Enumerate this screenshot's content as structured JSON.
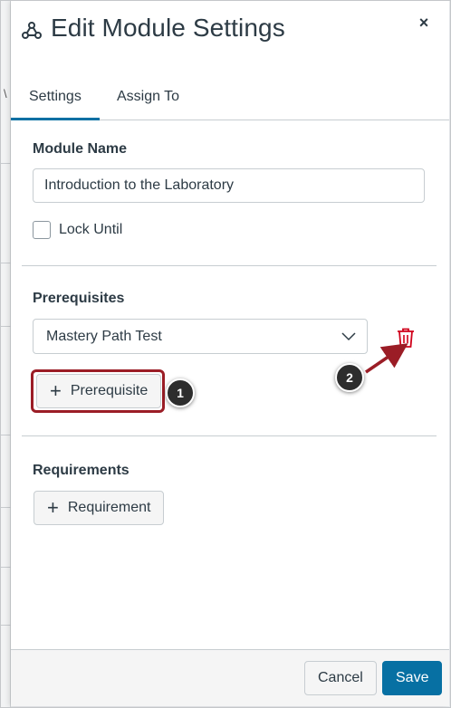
{
  "tray": {
    "title": "Edit Module Settings",
    "title_icon": "module-settings-icon",
    "close_label": "×"
  },
  "tabs": [
    {
      "label": "Settings",
      "active": true
    },
    {
      "label": "Assign To",
      "active": false
    }
  ],
  "module_name": {
    "label": "Module Name",
    "value": "Introduction to the Laboratory"
  },
  "lock_until": {
    "label": "Lock Until",
    "checked": false
  },
  "prerequisites": {
    "label": "Prerequisites",
    "selected": "Mastery Path Test",
    "add_label": "Prerequisite",
    "delete_icon": "trash-icon"
  },
  "requirements": {
    "label": "Requirements",
    "add_label": "Requirement"
  },
  "callouts": {
    "first": "1",
    "second": "2"
  },
  "footer": {
    "cancel_label": "Cancel",
    "save_label": "Save"
  },
  "colors": {
    "accent": "#0770a3",
    "danger": "#d0021b",
    "highlight": "#9b1d26"
  }
}
